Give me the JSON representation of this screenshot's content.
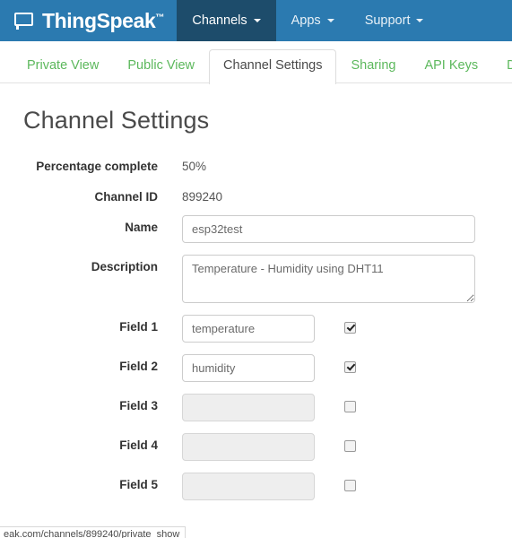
{
  "navbar": {
    "brand": "ThingSpeak",
    "brand_tm": "™",
    "brand_icon": "speech-bubble-icon",
    "background_color": "#2b7ab0",
    "active_color": "#1d4c6b",
    "items": [
      {
        "label": "Channels",
        "active": true,
        "has_caret": true
      },
      {
        "label": "Apps",
        "active": false,
        "has_caret": true
      },
      {
        "label": "Support",
        "active": false,
        "has_caret": true
      }
    ]
  },
  "tabs": {
    "link_color": "#5cb85c",
    "items": [
      {
        "label": "Private View",
        "active": false
      },
      {
        "label": "Public View",
        "active": false
      },
      {
        "label": "Channel Settings",
        "active": true
      },
      {
        "label": "Sharing",
        "active": false
      },
      {
        "label": "API Keys",
        "active": false
      },
      {
        "label": "Dat",
        "active": false
      }
    ]
  },
  "page": {
    "title": "Channel Settings"
  },
  "form": {
    "percentage_complete": {
      "label": "Percentage complete",
      "value": "50%"
    },
    "channel_id": {
      "label": "Channel ID",
      "value": "899240"
    },
    "name": {
      "label": "Name",
      "value": "esp32test"
    },
    "description": {
      "label": "Description",
      "value": "Temperature - Humidity using DHT11"
    },
    "fields": [
      {
        "label": "Field 1",
        "value": "temperature",
        "enabled": true,
        "checked": true
      },
      {
        "label": "Field 2",
        "value": "humidity",
        "enabled": true,
        "checked": true
      },
      {
        "label": "Field 3",
        "value": "",
        "enabled": false,
        "checked": false
      },
      {
        "label": "Field 4",
        "value": "",
        "enabled": false,
        "checked": false
      },
      {
        "label": "Field 5",
        "value": "",
        "enabled": false,
        "checked": false
      }
    ]
  },
  "statusbar": {
    "url": "eak.com/channels/899240/private_show"
  }
}
